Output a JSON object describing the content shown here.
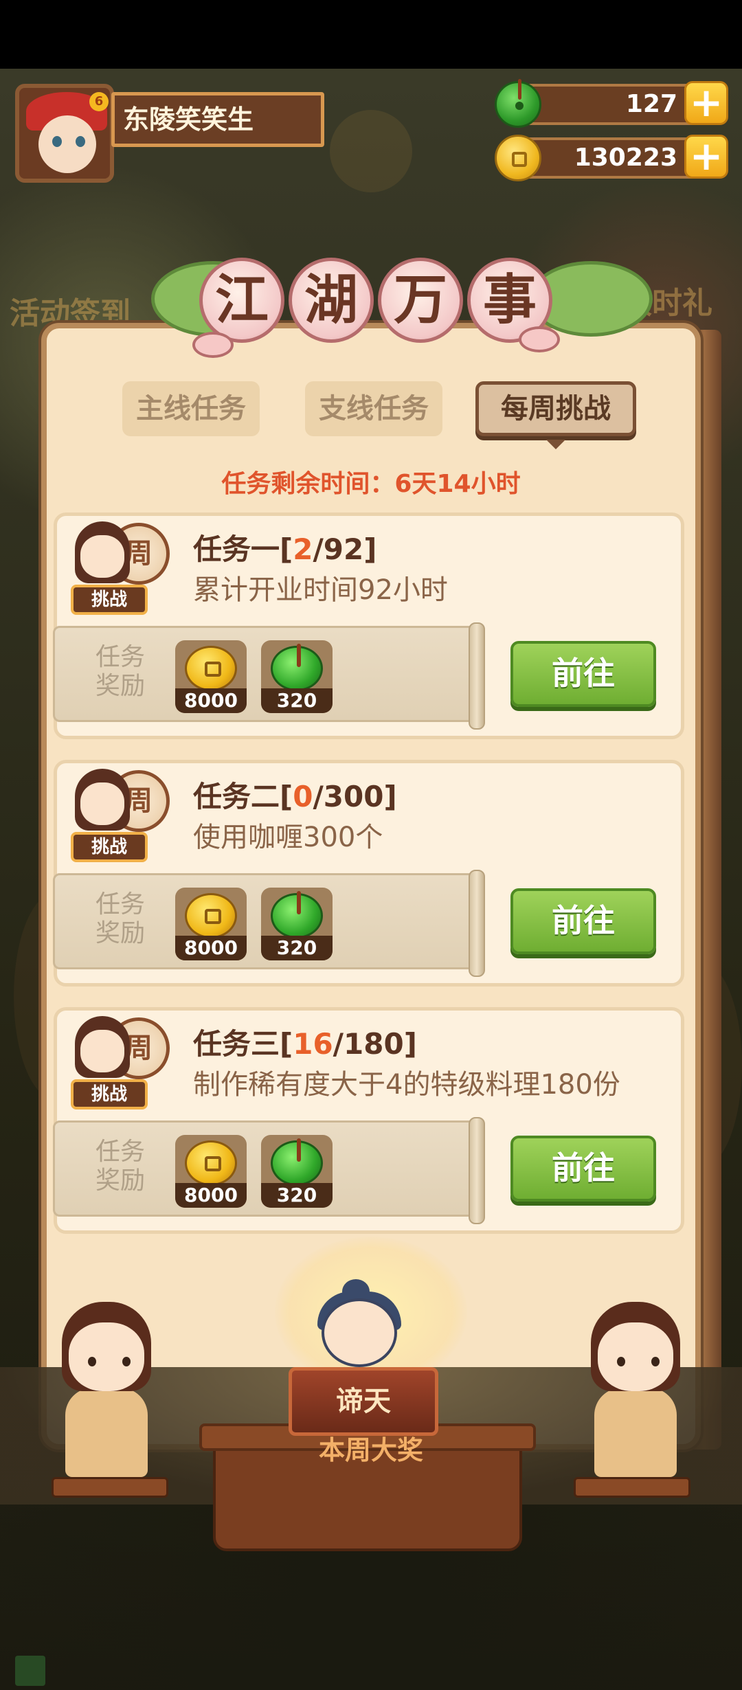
{
  "player": {
    "name": "东陵笑笑生"
  },
  "currency": {
    "jade": "127",
    "coins": "130223",
    "plus": "+"
  },
  "side": {
    "left_label": "活动签到",
    "right_label": "限时礼包"
  },
  "panel": {
    "title_chars": [
      "江",
      "湖",
      "万",
      "事"
    ],
    "tabs": [
      {
        "label": "主线任务",
        "active": false
      },
      {
        "label": "支线任务",
        "active": false
      },
      {
        "label": "每周挑战",
        "active": true
      }
    ],
    "timer": "任务剩余时间：6天14小时",
    "badge_drum": "周",
    "badge_tag": "挑战",
    "reward_label": "任务奖励",
    "go_label": "前往",
    "tasks": [
      {
        "name": "任务一",
        "current": "2",
        "total": "92",
        "desc": "累计开业时间92小时",
        "reward_coin": "8000",
        "reward_jade": "320"
      },
      {
        "name": "任务二",
        "current": "0",
        "total": "300",
        "desc": "使用咖喱300个",
        "reward_coin": "8000",
        "reward_jade": "320"
      },
      {
        "name": "任务三",
        "current": "16",
        "total": "180",
        "desc": "制作稀有度大于4的特级料理180份",
        "reward_coin": "8000",
        "reward_jade": "320"
      }
    ]
  },
  "bottom": {
    "prize_name": "谛天",
    "prize_caption": "本周大奖"
  },
  "colors": {
    "accent_red": "#e0542c",
    "progress_orange": "#e8602a",
    "go_green": "#7fbe3e",
    "panel_bg": "#f8e3c2"
  }
}
